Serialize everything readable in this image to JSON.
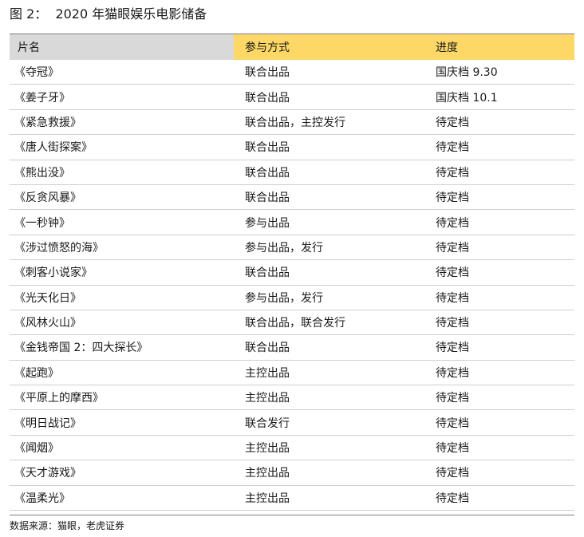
{
  "title": "图 2：  2020 年猫眼娱乐电影储备",
  "table": {
    "headers": [
      "片名",
      "参与方式",
      "进度"
    ],
    "rows": [
      [
        "《夺冠》",
        "联合出品",
        "国庆档 9.30"
      ],
      [
        "《姜子牙》",
        "联合出品",
        "国庆档 10.1"
      ],
      [
        "《紧急救援》",
        "联合出品，主控发行",
        "待定档"
      ],
      [
        "《唐人街探案》",
        "联合出品",
        "待定档"
      ],
      [
        "《熊出没》",
        "联合出品",
        "待定档"
      ],
      [
        "《反贪风暴》",
        "联合出品",
        "待定档"
      ],
      [
        "《一秒钟》",
        "参与出品",
        "待定档"
      ],
      [
        "《涉过愤怒的海》",
        "参与出品，发行",
        "待定档"
      ],
      [
        "《刺客小说家》",
        "联合出品",
        "待定档"
      ],
      [
        "《光天化日》",
        "参与出品，发行",
        "待定档"
      ],
      [
        "《风林火山》",
        "联合出品，联合发行",
        "待定档"
      ],
      [
        "《金钱帝国 2：四大探长》",
        "联合出品",
        "待定档"
      ],
      [
        "《起跑》",
        "主控出品",
        "待定档"
      ],
      [
        "《平原上的摩西》",
        "主控出品",
        "待定档"
      ],
      [
        "《明日战记》",
        "联合发行",
        "待定档"
      ],
      [
        "《闻烟》",
        "主控出品",
        "待定档"
      ],
      [
        "《天才游戏》",
        "主控出品",
        "待定档"
      ],
      [
        "《温柔光》",
        "主控出品",
        "待定档"
      ]
    ]
  },
  "source": "数据来源：猫眼，老虎证券",
  "colors": {
    "header_name_bg": "#d9d9d9",
    "header_accent_bg": "#fdd866"
  }
}
